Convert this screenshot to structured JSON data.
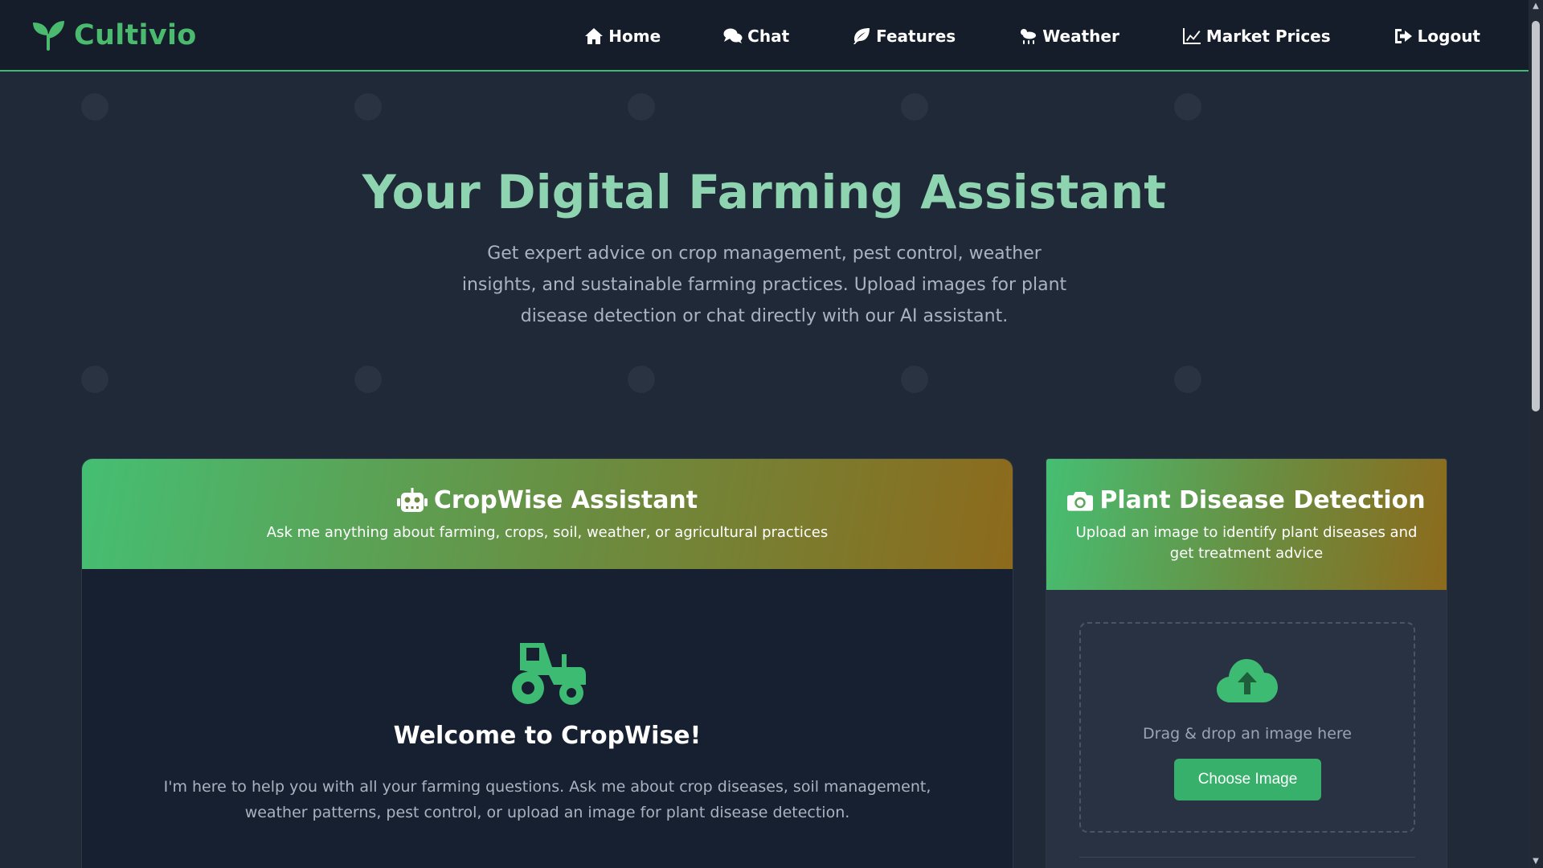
{
  "brand": {
    "name": "Cultivio",
    "icon": "seedling-icon"
  },
  "nav": {
    "items": [
      {
        "label": "Home",
        "icon": "home-icon"
      },
      {
        "label": "Chat",
        "icon": "comments-icon"
      },
      {
        "label": "Features",
        "icon": "leaf-icon"
      },
      {
        "label": "Weather",
        "icon": "cloud-sun-rain-icon"
      },
      {
        "label": "Market Prices",
        "icon": "chart-line-icon"
      },
      {
        "label": "Logout",
        "icon": "sign-out-icon"
      }
    ]
  },
  "hero": {
    "title": "Your Digital Farming Assistant",
    "subtitle": "Get expert advice on crop management, pest control, weather insights, and sustainable farming practices. Upload images for plant disease detection or chat directly with our AI assistant."
  },
  "assistant": {
    "title": "CropWise Assistant",
    "description": "Ask me anything about farming, crops, soil, weather, or agricultural practices",
    "icon": "robot-icon",
    "welcome_icon": "tractor-icon",
    "welcome_title": "Welcome to CropWise!",
    "welcome_text": "I'm here to help you with all your farming questions. Ask me about crop diseases, soil management, weather patterns, pest control, or upload an image for plant disease detection."
  },
  "detection": {
    "title": "Plant Disease Detection",
    "description": "Upload an image to identify plant diseases and get treatment advice",
    "icon": "camera-icon",
    "upload_icon": "cloud-upload-icon",
    "drop_text": "Drag & drop an image here",
    "button_label": "Choose Image"
  },
  "colors": {
    "accent": "#3dbb73",
    "brand_green": "#4aba6e",
    "hero_title": "#8fd4b0",
    "header_gradient_start": "#45bf73",
    "header_gradient_end": "#8d6a1c",
    "background": "#1f2937"
  }
}
